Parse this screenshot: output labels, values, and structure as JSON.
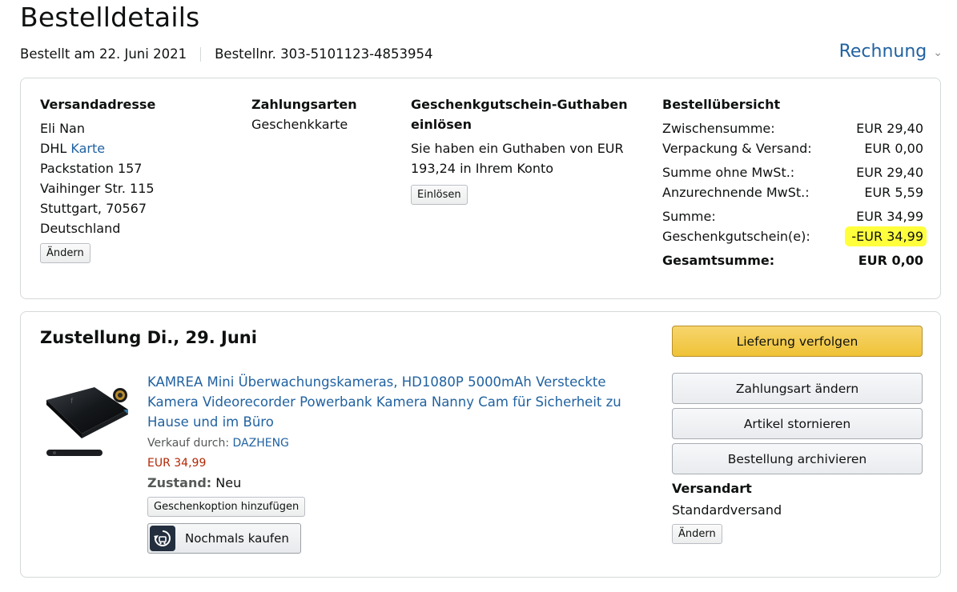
{
  "header": {
    "title": "Bestelldetails",
    "ordered_on": "Bestellt am 22. Juni 2021",
    "order_number": "Bestellnr. 303-5101123-4853954",
    "invoice_label": "Rechnung"
  },
  "shipping_address": {
    "heading": "Versandadresse",
    "name": "Eli Nan",
    "carrier_prefix": "DHL",
    "carrier_link": "Karte",
    "line1": "Packstation 157",
    "line2": "Vaihinger Str. 115",
    "line3": "Stuttgart, 70567",
    "country": "Deutschland",
    "change_label": "Ändern"
  },
  "payment": {
    "heading": "Zahlungsarten",
    "method": "Geschenkkarte"
  },
  "gift_card": {
    "heading": "Geschenkgutschein-Guthaben einlösen",
    "text": "Sie haben ein Guthaben von EUR 193,24 in Ihrem Konto",
    "redeem_label": "Einlösen"
  },
  "overview": {
    "heading": "Bestellübersicht",
    "rows": [
      {
        "label": "Zwischensumme:",
        "value": "EUR 29,40"
      },
      {
        "label": "Verpackung & Versand:",
        "value": "EUR 0,00"
      },
      {
        "label": "Summe ohne MwSt.:",
        "value": "EUR 29,40"
      },
      {
        "label": "Anzurechnende MwSt.:",
        "value": "EUR 5,59"
      },
      {
        "label": "Summe:",
        "value": "EUR 34,99"
      },
      {
        "label": "Geschenkgutschein(e):",
        "value": "-EUR 34,99"
      }
    ],
    "total_label": "Gesamtsumme:",
    "total_value": "EUR 0,00",
    "highlight_color": "#ffff3c"
  },
  "shipment": {
    "delivery_title": "Zustellung Di., 29. Juni",
    "product_title": "KAMREA Mini Überwachungskameras, HD1080P 5000mAh Versteckte Kamera Videorecorder Powerbank Kamera Nanny Cam für Sicherheit zu Hause und im Büro",
    "seller_prefix": "Verkauf durch:",
    "seller": "DAZHENG",
    "price": "EUR 34,99",
    "condition_label": "Zustand:",
    "condition_value": "Neu",
    "gift_option_label": "Geschenkoption hinzufügen",
    "buy_again_label": "Nochmals kaufen",
    "buttons": {
      "track": "Lieferung verfolgen",
      "change_payment": "Zahlungsart ändern",
      "cancel": "Artikel stornieren",
      "archive": "Bestellung archivieren"
    },
    "shipping_type_label": "Versandart",
    "shipping_type": "Standardversand",
    "shipping_change_label": "Ändern"
  },
  "colors": {
    "link": "#2162a1",
    "price": "#b12704",
    "primary_button": "#f0c14b"
  }
}
